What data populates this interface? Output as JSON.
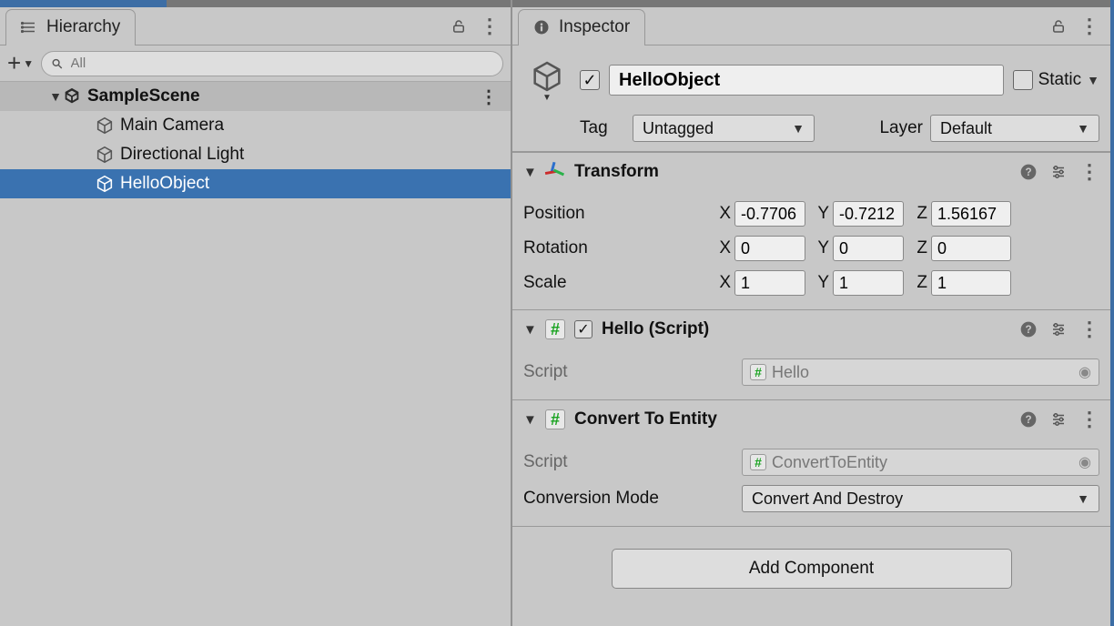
{
  "hierarchy": {
    "tab_title": "Hierarchy",
    "search_placeholder": "All",
    "scene": "SampleScene",
    "items": [
      {
        "label": "Main Camera"
      },
      {
        "label": "Directional Light"
      },
      {
        "label": "HelloObject"
      }
    ]
  },
  "inspector": {
    "tab_title": "Inspector",
    "object_name": "HelloObject",
    "active": true,
    "static_label": "Static",
    "static_checked": false,
    "tag_label": "Tag",
    "tag_value": "Untagged",
    "layer_label": "Layer",
    "layer_value": "Default",
    "transform": {
      "title": "Transform",
      "position_label": "Position",
      "position": {
        "x": "-0.7706",
        "y": "-0.7212",
        "z": "1.56167"
      },
      "rotation_label": "Rotation",
      "rotation": {
        "x": "0",
        "y": "0",
        "z": "0"
      },
      "scale_label": "Scale",
      "scale": {
        "x": "1",
        "y": "1",
        "z": "1"
      }
    },
    "hello": {
      "title": "Hello (Script)",
      "enabled": true,
      "script_label": "Script",
      "script_name": "Hello"
    },
    "convert": {
      "title": "Convert To Entity",
      "script_label": "Script",
      "script_name": "ConvertToEntity",
      "mode_label": "Conversion Mode",
      "mode_value": "Convert And Destroy"
    },
    "add_component": "Add Component"
  },
  "axis": {
    "x": "X",
    "y": "Y",
    "z": "Z"
  }
}
